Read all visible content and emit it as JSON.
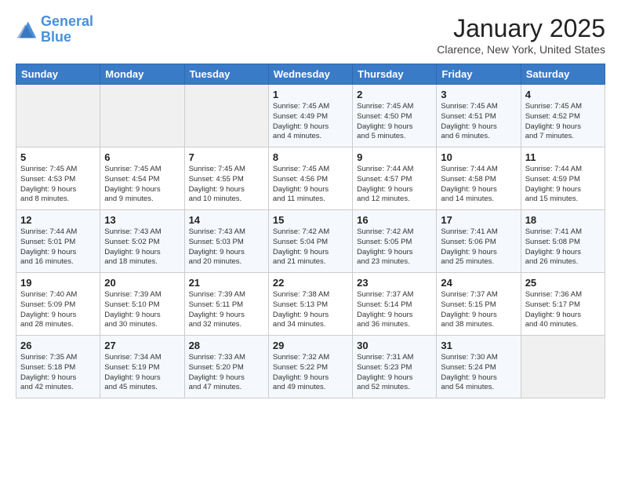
{
  "header": {
    "logo_line1": "General",
    "logo_line2": "Blue",
    "title": "January 2025",
    "location": "Clarence, New York, United States"
  },
  "weekdays": [
    "Sunday",
    "Monday",
    "Tuesday",
    "Wednesday",
    "Thursday",
    "Friday",
    "Saturday"
  ],
  "weeks": [
    [
      {
        "day": "",
        "info": ""
      },
      {
        "day": "",
        "info": ""
      },
      {
        "day": "",
        "info": ""
      },
      {
        "day": "1",
        "info": "Sunrise: 7:45 AM\nSunset: 4:49 PM\nDaylight: 9 hours\nand 4 minutes."
      },
      {
        "day": "2",
        "info": "Sunrise: 7:45 AM\nSunset: 4:50 PM\nDaylight: 9 hours\nand 5 minutes."
      },
      {
        "day": "3",
        "info": "Sunrise: 7:45 AM\nSunset: 4:51 PM\nDaylight: 9 hours\nand 6 minutes."
      },
      {
        "day": "4",
        "info": "Sunrise: 7:45 AM\nSunset: 4:52 PM\nDaylight: 9 hours\nand 7 minutes."
      }
    ],
    [
      {
        "day": "5",
        "info": "Sunrise: 7:45 AM\nSunset: 4:53 PM\nDaylight: 9 hours\nand 8 minutes."
      },
      {
        "day": "6",
        "info": "Sunrise: 7:45 AM\nSunset: 4:54 PM\nDaylight: 9 hours\nand 9 minutes."
      },
      {
        "day": "7",
        "info": "Sunrise: 7:45 AM\nSunset: 4:55 PM\nDaylight: 9 hours\nand 10 minutes."
      },
      {
        "day": "8",
        "info": "Sunrise: 7:45 AM\nSunset: 4:56 PM\nDaylight: 9 hours\nand 11 minutes."
      },
      {
        "day": "9",
        "info": "Sunrise: 7:44 AM\nSunset: 4:57 PM\nDaylight: 9 hours\nand 12 minutes."
      },
      {
        "day": "10",
        "info": "Sunrise: 7:44 AM\nSunset: 4:58 PM\nDaylight: 9 hours\nand 14 minutes."
      },
      {
        "day": "11",
        "info": "Sunrise: 7:44 AM\nSunset: 4:59 PM\nDaylight: 9 hours\nand 15 minutes."
      }
    ],
    [
      {
        "day": "12",
        "info": "Sunrise: 7:44 AM\nSunset: 5:01 PM\nDaylight: 9 hours\nand 16 minutes."
      },
      {
        "day": "13",
        "info": "Sunrise: 7:43 AM\nSunset: 5:02 PM\nDaylight: 9 hours\nand 18 minutes."
      },
      {
        "day": "14",
        "info": "Sunrise: 7:43 AM\nSunset: 5:03 PM\nDaylight: 9 hours\nand 20 minutes."
      },
      {
        "day": "15",
        "info": "Sunrise: 7:42 AM\nSunset: 5:04 PM\nDaylight: 9 hours\nand 21 minutes."
      },
      {
        "day": "16",
        "info": "Sunrise: 7:42 AM\nSunset: 5:05 PM\nDaylight: 9 hours\nand 23 minutes."
      },
      {
        "day": "17",
        "info": "Sunrise: 7:41 AM\nSunset: 5:06 PM\nDaylight: 9 hours\nand 25 minutes."
      },
      {
        "day": "18",
        "info": "Sunrise: 7:41 AM\nSunset: 5:08 PM\nDaylight: 9 hours\nand 26 minutes."
      }
    ],
    [
      {
        "day": "19",
        "info": "Sunrise: 7:40 AM\nSunset: 5:09 PM\nDaylight: 9 hours\nand 28 minutes."
      },
      {
        "day": "20",
        "info": "Sunrise: 7:39 AM\nSunset: 5:10 PM\nDaylight: 9 hours\nand 30 minutes."
      },
      {
        "day": "21",
        "info": "Sunrise: 7:39 AM\nSunset: 5:11 PM\nDaylight: 9 hours\nand 32 minutes."
      },
      {
        "day": "22",
        "info": "Sunrise: 7:38 AM\nSunset: 5:13 PM\nDaylight: 9 hours\nand 34 minutes."
      },
      {
        "day": "23",
        "info": "Sunrise: 7:37 AM\nSunset: 5:14 PM\nDaylight: 9 hours\nand 36 minutes."
      },
      {
        "day": "24",
        "info": "Sunrise: 7:37 AM\nSunset: 5:15 PM\nDaylight: 9 hours\nand 38 minutes."
      },
      {
        "day": "25",
        "info": "Sunrise: 7:36 AM\nSunset: 5:17 PM\nDaylight: 9 hours\nand 40 minutes."
      }
    ],
    [
      {
        "day": "26",
        "info": "Sunrise: 7:35 AM\nSunset: 5:18 PM\nDaylight: 9 hours\nand 42 minutes."
      },
      {
        "day": "27",
        "info": "Sunrise: 7:34 AM\nSunset: 5:19 PM\nDaylight: 9 hours\nand 45 minutes."
      },
      {
        "day": "28",
        "info": "Sunrise: 7:33 AM\nSunset: 5:20 PM\nDaylight: 9 hours\nand 47 minutes."
      },
      {
        "day": "29",
        "info": "Sunrise: 7:32 AM\nSunset: 5:22 PM\nDaylight: 9 hours\nand 49 minutes."
      },
      {
        "day": "30",
        "info": "Sunrise: 7:31 AM\nSunset: 5:23 PM\nDaylight: 9 hours\nand 52 minutes."
      },
      {
        "day": "31",
        "info": "Sunrise: 7:30 AM\nSunset: 5:24 PM\nDaylight: 9 hours\nand 54 minutes."
      },
      {
        "day": "",
        "info": ""
      }
    ]
  ]
}
